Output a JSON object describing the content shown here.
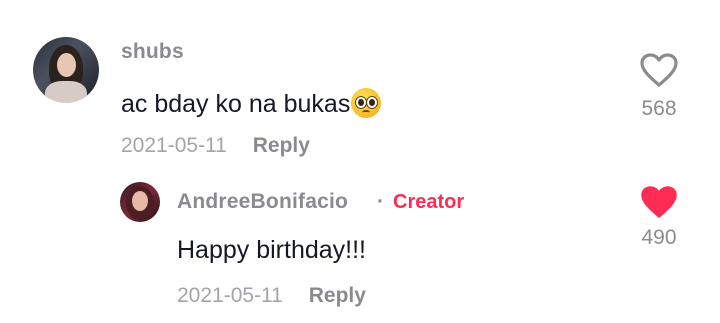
{
  "comments": [
    {
      "username": "shubs",
      "text": "ac bday ko na bukas",
      "emoji": "pleading-face-emoji",
      "date": "2021-05-11",
      "reply_label": "Reply",
      "likes": "568",
      "liked": false,
      "avatar": "user-avatar"
    },
    {
      "username": "AndreeBonifacio",
      "separator": "·",
      "badge": "Creator",
      "text": "Happy birthday!!!",
      "date": "2021-05-11",
      "reply_label": "Reply",
      "likes": "490",
      "liked": true,
      "avatar": "creator-avatar"
    }
  ],
  "colors": {
    "like_active": "#fe2c55",
    "creator_badge": "#fe2c55",
    "muted_text": "#8a8b91",
    "body_text": "#161823"
  },
  "icons": {
    "like_outline": "heart-outline-icon",
    "like_filled": "heart-filled-icon"
  }
}
